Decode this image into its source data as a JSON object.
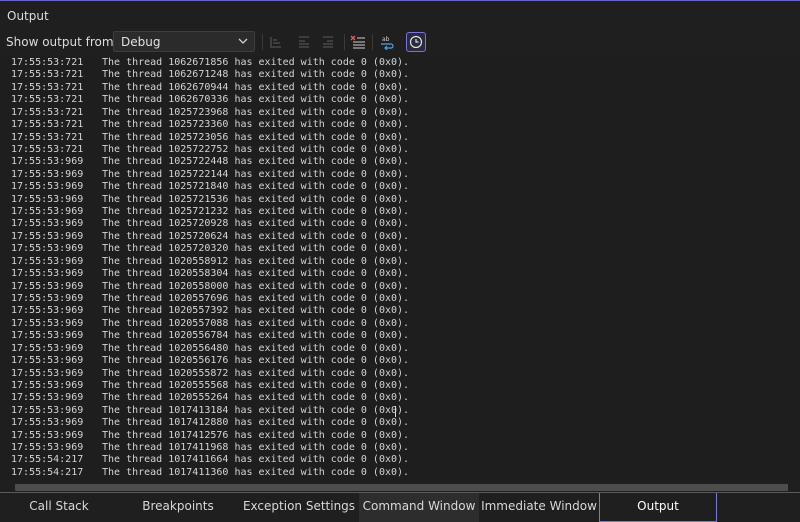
{
  "panel": {
    "title": "Output"
  },
  "toolbar": {
    "show_output_label": "Show output from:",
    "source_selected": "Debug",
    "buttons": [
      "find-message-in-code-icon",
      "go-to-previous-message-icon",
      "go-to-next-message-icon",
      "clear-all-icon",
      "toggle-word-wrap-icon",
      "toggle-timestamps-icon"
    ]
  },
  "lines": [
    {
      "time": "17:55:53:721",
      "msg": "The thread 1062671856 has exited with code 0 (0x0)."
    },
    {
      "time": "17:55:53:721",
      "msg": "The thread 1062671248 has exited with code 0 (0x0)."
    },
    {
      "time": "17:55:53:721",
      "msg": "The thread 1062670944 has exited with code 0 (0x0)."
    },
    {
      "time": "17:55:53:721",
      "msg": "The thread 1062670336 has exited with code 0 (0x0)."
    },
    {
      "time": "17:55:53:721",
      "msg": "The thread 1025723968 has exited with code 0 (0x0)."
    },
    {
      "time": "17:55:53:721",
      "msg": "The thread 1025723360 has exited with code 0 (0x0)."
    },
    {
      "time": "17:55:53:721",
      "msg": "The thread 1025723056 has exited with code 0 (0x0)."
    },
    {
      "time": "17:55:53:721",
      "msg": "The thread 1025722752 has exited with code 0 (0x0)."
    },
    {
      "time": "17:55:53:969",
      "msg": "The thread 1025722448 has exited with code 0 (0x0)."
    },
    {
      "time": "17:55:53:969",
      "msg": "The thread 1025722144 has exited with code 0 (0x0)."
    },
    {
      "time": "17:55:53:969",
      "msg": "The thread 1025721840 has exited with code 0 (0x0)."
    },
    {
      "time": "17:55:53:969",
      "msg": "The thread 1025721536 has exited with code 0 (0x0)."
    },
    {
      "time": "17:55:53:969",
      "msg": "The thread 1025721232 has exited with code 0 (0x0)."
    },
    {
      "time": "17:55:53:969",
      "msg": "The thread 1025720928 has exited with code 0 (0x0)."
    },
    {
      "time": "17:55:53:969",
      "msg": "The thread 1025720624 has exited with code 0 (0x0)."
    },
    {
      "time": "17:55:53:969",
      "msg": "The thread 1025720320 has exited with code 0 (0x0)."
    },
    {
      "time": "17:55:53:969",
      "msg": "The thread 1020558912 has exited with code 0 (0x0)."
    },
    {
      "time": "17:55:53:969",
      "msg": "The thread 1020558304 has exited with code 0 (0x0)."
    },
    {
      "time": "17:55:53:969",
      "msg": "The thread 1020558000 has exited with code 0 (0x0)."
    },
    {
      "time": "17:55:53:969",
      "msg": "The thread 1020557696 has exited with code 0 (0x0)."
    },
    {
      "time": "17:55:53:969",
      "msg": "The thread 1020557392 has exited with code 0 (0x0)."
    },
    {
      "time": "17:55:53:969",
      "msg": "The thread 1020557088 has exited with code 0 (0x0)."
    },
    {
      "time": "17:55:53:969",
      "msg": "The thread 1020556784 has exited with code 0 (0x0)."
    },
    {
      "time": "17:55:53:969",
      "msg": "The thread 1020556480 has exited with code 0 (0x0)."
    },
    {
      "time": "17:55:53:969",
      "msg": "The thread 1020556176 has exited with code 0 (0x0)."
    },
    {
      "time": "17:55:53:969",
      "msg": "The thread 1020555872 has exited with code 0 (0x0)."
    },
    {
      "time": "17:55:53:969",
      "msg": "The thread 1020555568 has exited with code 0 (0x0)."
    },
    {
      "time": "17:55:53:969",
      "msg": "The thread 1020555264 has exited with code 0 (0x0)."
    },
    {
      "time": "17:55:53:969",
      "msg": "The thread 1017413184 has exited with code 0 (0x0)."
    },
    {
      "time": "17:55:53:969",
      "msg": "The thread 1017412880 has exited with code 0 (0x0)."
    },
    {
      "time": "17:55:53:969",
      "msg": "The thread 1017412576 has exited with code 0 (0x0)."
    },
    {
      "time": "17:55:53:969",
      "msg": "The thread 1017411968 has exited with code 0 (0x0)."
    },
    {
      "time": "17:55:54:217",
      "msg": "The thread 1017411664 has exited with code 0 (0x0)."
    },
    {
      "time": "17:55:54:217",
      "msg": "The thread 1017411360 has exited with code 0 (0x0)."
    }
  ],
  "tabs": [
    "Call Stack",
    "Breakpoints",
    "Exception Settings",
    "Command Window",
    "Immediate Window",
    "Output"
  ],
  "active_tab": "Output",
  "colors": {
    "accent": "#7a74d6",
    "background": "#1f1f1f",
    "text": "#d4d4d4"
  }
}
